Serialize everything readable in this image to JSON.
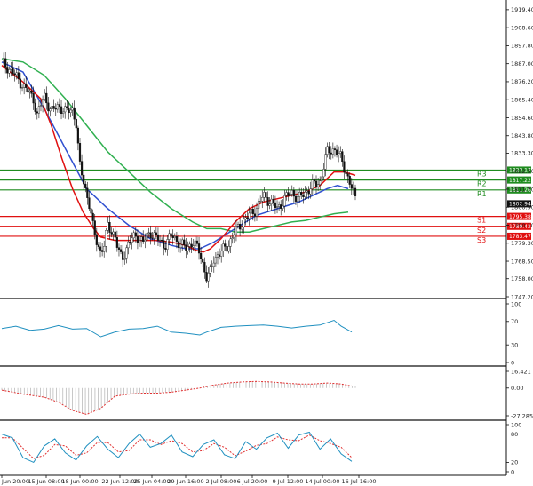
{
  "chart_data": {
    "type": "candlestick",
    "x_ticks": [
      "Jun 20:00",
      "15 Jun 08:00",
      "18 Jun 00:00",
      "22 Jun 12:00",
      "25 Jun 04:00",
      "29 Jun 16:00",
      "2 Jul 08:00",
      "6 Jul 20:00",
      "9 Jul 12:00",
      "14 Jul 00:00",
      "16 Jul 16:00"
    ],
    "y_ticks": [
      "1919.40",
      "1908.60",
      "1897.80",
      "1887.00",
      "1876.20",
      "1865.40",
      "1854.60",
      "1843.80",
      "1833.30",
      "1822.50",
      "1811.70",
      "1800.90",
      "1790.10",
      "1779.30",
      "1768.50",
      "1758.00",
      "1747.20"
    ],
    "ylim": [
      1747.2,
      1922.0
    ],
    "current_price": "1802.94",
    "levels": [
      {
        "name": "R3",
        "value": 1823.17,
        "label": "1823.17",
        "color": "#1f8c1f"
      },
      {
        "name": "R2",
        "value": 1817.22,
        "label": "1817.22",
        "color": "#1f8c1f"
      },
      {
        "name": "R1",
        "value": 1811.26,
        "label": "1811.26",
        "color": "#1f8c1f"
      },
      {
        "name": "S1",
        "value": 1795.38,
        "label": "1795.38",
        "color": "#e01010"
      },
      {
        "name": "S2",
        "value": 1789.42,
        "label": "1789.42",
        "color": "#e01010"
      },
      {
        "name": "S3",
        "value": 1783.47,
        "label": "1783.47",
        "color": "#e01010"
      }
    ],
    "price_path": [
      [
        0,
        1888
      ],
      [
        3,
        1882
      ],
      [
        6,
        1874
      ],
      [
        9,
        1866
      ],
      [
        10,
        1856
      ],
      [
        12,
        1868
      ],
      [
        14,
        1858
      ],
      [
        16,
        1862
      ],
      [
        18,
        1858
      ],
      [
        20,
        1860
      ],
      [
        21,
        1852
      ],
      [
        22,
        1826
      ],
      [
        23,
        1818
      ],
      [
        25,
        1800
      ],
      [
        26,
        1786
      ],
      [
        28,
        1774
      ],
      [
        29,
        1778
      ],
      [
        30,
        1790
      ],
      [
        32,
        1784
      ],
      [
        33,
        1774
      ],
      [
        34,
        1770
      ],
      [
        36,
        1780
      ],
      [
        38,
        1784
      ],
      [
        40,
        1780
      ],
      [
        42,
        1786
      ],
      [
        44,
        1782
      ],
      [
        46,
        1778
      ],
      [
        48,
        1784
      ],
      [
        50,
        1780
      ],
      [
        52,
        1776
      ],
      [
        54,
        1780
      ],
      [
        56,
        1774
      ],
      [
        57,
        1766
      ],
      [
        58,
        1758
      ],
      [
        59,
        1762
      ],
      [
        60,
        1770
      ],
      [
        62,
        1774
      ],
      [
        64,
        1778
      ],
      [
        66,
        1786
      ],
      [
        68,
        1792
      ],
      [
        70,
        1796
      ],
      [
        72,
        1800
      ],
      [
        74,
        1808
      ],
      [
        76,
        1804
      ],
      [
        78,
        1800
      ],
      [
        80,
        1806
      ],
      [
        82,
        1810
      ],
      [
        84,
        1806
      ],
      [
        86,
        1810
      ],
      [
        88,
        1814
      ],
      [
        90,
        1816
      ],
      [
        92,
        1834
      ],
      [
        94,
        1836
      ],
      [
        96,
        1830
      ],
      [
        98,
        1818
      ],
      [
        99,
        1812
      ],
      [
        100,
        1806
      ]
    ],
    "ma_fast": [
      [
        0,
        1886
      ],
      [
        6,
        1876
      ],
      [
        11,
        1866
      ],
      [
        14,
        1850
      ],
      [
        17,
        1830
      ],
      [
        20,
        1812
      ],
      [
        23,
        1798
      ],
      [
        26,
        1788
      ],
      [
        28,
        1783
      ],
      [
        32,
        1781
      ],
      [
        38,
        1781
      ],
      [
        44,
        1781
      ],
      [
        48,
        1780
      ],
      [
        52,
        1778
      ],
      [
        55,
        1775
      ],
      [
        57,
        1774
      ],
      [
        59,
        1776
      ],
      [
        62,
        1782
      ],
      [
        66,
        1792
      ],
      [
        70,
        1800
      ],
      [
        74,
        1804
      ],
      [
        78,
        1806
      ],
      [
        82,
        1808
      ],
      [
        86,
        1810
      ],
      [
        90,
        1814
      ],
      [
        94,
        1822
      ],
      [
        97,
        1822
      ],
      [
        100,
        1820
      ]
    ],
    "ma_mid": [
      [
        0,
        1888
      ],
      [
        6,
        1882
      ],
      [
        12,
        1860
      ],
      [
        18,
        1836
      ],
      [
        24,
        1812
      ],
      [
        30,
        1800
      ],
      [
        36,
        1790
      ],
      [
        42,
        1782
      ],
      [
        48,
        1778
      ],
      [
        52,
        1776
      ],
      [
        56,
        1776
      ],
      [
        60,
        1780
      ],
      [
        66,
        1788
      ],
      [
        72,
        1796
      ],
      [
        78,
        1800
      ],
      [
        84,
        1804
      ],
      [
        88,
        1808
      ],
      [
        92,
        1812
      ],
      [
        95,
        1814
      ],
      [
        98,
        1812
      ]
    ],
    "ma_slow": [
      [
        0,
        1890
      ],
      [
        6,
        1888
      ],
      [
        12,
        1880
      ],
      [
        18,
        1866
      ],
      [
        24,
        1850
      ],
      [
        30,
        1834
      ],
      [
        36,
        1822
      ],
      [
        42,
        1810
      ],
      [
        48,
        1800
      ],
      [
        54,
        1792
      ],
      [
        58,
        1788
      ],
      [
        62,
        1788
      ],
      [
        66,
        1786
      ],
      [
        70,
        1786
      ],
      [
        74,
        1788
      ],
      [
        78,
        1790
      ],
      [
        82,
        1792
      ],
      [
        86,
        1793
      ],
      [
        90,
        1795
      ],
      [
        94,
        1797
      ],
      [
        98,
        1798
      ]
    ],
    "colors": {
      "bull": "#1a8a1a",
      "bear": "#c00000",
      "ma_fast": "#e01010",
      "ma_mid": "#3050d0",
      "ma_slow": "#30b050",
      "osc": "#2090c0",
      "macd": "#e03030"
    },
    "indicator1": {
      "ticks": [
        "100",
        "70",
        "30",
        "0"
      ],
      "ylim": [
        0,
        100
      ],
      "values": [
        [
          0,
          58
        ],
        [
          4,
          62
        ],
        [
          8,
          55
        ],
        [
          12,
          57
        ],
        [
          16,
          63
        ],
        [
          20,
          57
        ],
        [
          24,
          58
        ],
        [
          28,
          44
        ],
        [
          32,
          52
        ],
        [
          36,
          57
        ],
        [
          40,
          58
        ],
        [
          44,
          62
        ],
        [
          48,
          52
        ],
        [
          52,
          50
        ],
        [
          56,
          47
        ],
        [
          58,
          52
        ],
        [
          62,
          60
        ],
        [
          66,
          62
        ],
        [
          70,
          63
        ],
        [
          74,
          64
        ],
        [
          78,
          62
        ],
        [
          82,
          59
        ],
        [
          86,
          62
        ],
        [
          90,
          64
        ],
        [
          94,
          72
        ],
        [
          96,
          62
        ],
        [
          99,
          52
        ]
      ]
    },
    "indicator2": {
      "ticks": [
        "16.421",
        "0.00",
        "-27.285"
      ],
      "ylim": [
        -27.285,
        16.421
      ],
      "values": [
        [
          0,
          -2
        ],
        [
          6,
          -6
        ],
        [
          12,
          -9
        ],
        [
          16,
          -14
        ],
        [
          20,
          -22
        ],
        [
          24,
          -26
        ],
        [
          28,
          -20
        ],
        [
          32,
          -8
        ],
        [
          36,
          -6
        ],
        [
          40,
          -5
        ],
        [
          44,
          -5
        ],
        [
          48,
          -4
        ],
        [
          52,
          -2
        ],
        [
          56,
          0
        ],
        [
          60,
          3
        ],
        [
          64,
          5
        ],
        [
          68,
          6
        ],
        [
          72,
          6.5
        ],
        [
          76,
          6
        ],
        [
          80,
          5
        ],
        [
          84,
          4
        ],
        [
          88,
          4
        ],
        [
          92,
          5
        ],
        [
          96,
          4
        ],
        [
          99,
          2
        ]
      ]
    },
    "indicator3": {
      "ticks": [
        "100",
        "80",
        "20",
        "0"
      ],
      "ylim": [
        0,
        100
      ],
      "values": [
        [
          0,
          80
        ],
        [
          3,
          72
        ],
        [
          6,
          30
        ],
        [
          9,
          20
        ],
        [
          12,
          55
        ],
        [
          15,
          70
        ],
        [
          18,
          40
        ],
        [
          21,
          25
        ],
        [
          24,
          55
        ],
        [
          27,
          75
        ],
        [
          30,
          48
        ],
        [
          33,
          30
        ],
        [
          36,
          60
        ],
        [
          39,
          80
        ],
        [
          42,
          52
        ],
        [
          45,
          60
        ],
        [
          48,
          78
        ],
        [
          51,
          42
        ],
        [
          54,
          32
        ],
        [
          57,
          58
        ],
        [
          60,
          68
        ],
        [
          63,
          36
        ],
        [
          66,
          28
        ],
        [
          69,
          64
        ],
        [
          72,
          48
        ],
        [
          75,
          72
        ],
        [
          78,
          82
        ],
        [
          81,
          50
        ],
        [
          84,
          78
        ],
        [
          87,
          84
        ],
        [
          90,
          48
        ],
        [
          93,
          70
        ],
        [
          96,
          38
        ],
        [
          99,
          22
        ]
      ],
      "signal": [
        [
          0,
          72
        ],
        [
          3,
          72
        ],
        [
          6,
          50
        ],
        [
          9,
          28
        ],
        [
          12,
          35
        ],
        [
          15,
          58
        ],
        [
          18,
          55
        ],
        [
          21,
          35
        ],
        [
          24,
          40
        ],
        [
          27,
          62
        ],
        [
          30,
          62
        ],
        [
          33,
          42
        ],
        [
          36,
          45
        ],
        [
          39,
          68
        ],
        [
          42,
          68
        ],
        [
          45,
          58
        ],
        [
          48,
          66
        ],
        [
          51,
          60
        ],
        [
          54,
          42
        ],
        [
          57,
          45
        ],
        [
          60,
          60
        ],
        [
          63,
          52
        ],
        [
          66,
          34
        ],
        [
          69,
          44
        ],
        [
          72,
          56
        ],
        [
          75,
          60
        ],
        [
          78,
          74
        ],
        [
          81,
          68
        ],
        [
          84,
          66
        ],
        [
          87,
          78
        ],
        [
          90,
          66
        ],
        [
          93,
          60
        ],
        [
          96,
          52
        ],
        [
          99,
          30
        ]
      ]
    }
  }
}
